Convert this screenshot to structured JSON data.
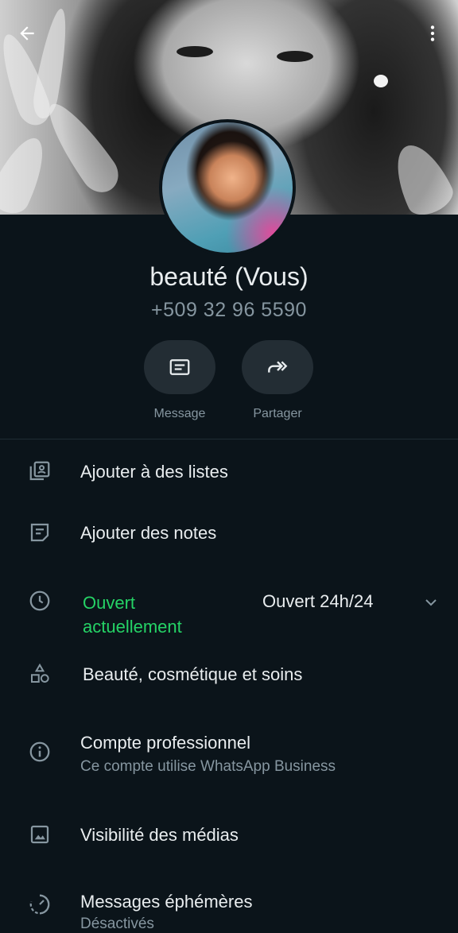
{
  "profile": {
    "name": "beauté (Vous)",
    "phone": "+509 32 96 5590"
  },
  "actions": {
    "message_label": "Message",
    "share_label": "Partager"
  },
  "menu": {
    "lists": "Ajouter à des listes",
    "notes": "Ajouter des notes",
    "hours_status": "Ouvert actuellement",
    "hours_value": "Ouvert 24h/24",
    "category": "Beauté, cosmétique et soins",
    "business_title": "Compte professionnel",
    "business_sub": "Ce compte utilise WhatsApp Business",
    "media": "Visibilité des médias",
    "ephemeral_title": "Messages éphémères",
    "ephemeral_sub": "Désactivés"
  },
  "colors": {
    "background": "#0b141a",
    "accent_green": "#25d366",
    "secondary_text": "#8696a0",
    "button_bg": "#232d34"
  },
  "icons": [
    "back-arrow-icon",
    "more-vert-icon",
    "message-icon",
    "share-icon",
    "lists-icon",
    "notes-icon",
    "clock-icon",
    "category-icon",
    "info-icon",
    "image-icon",
    "timer-icon",
    "chevron-down-icon"
  ]
}
